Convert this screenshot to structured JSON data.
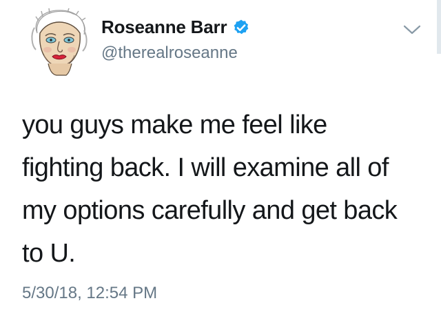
{
  "tweet": {
    "author": {
      "display_name": "Roseanne Barr",
      "handle": "@therealroseanne",
      "verified": true,
      "avatar": "sketched-portrait-avatar"
    },
    "text": "you guys make me feel like\nfighting back. I will examine all of\nmy options carefully and get back\nto U.",
    "timestamp": "5/30/18, 12:54 PM"
  },
  "icons": {
    "verified": "verified-badge-icon",
    "menu": "chevron-down-icon"
  },
  "colors": {
    "text": "#14171a",
    "secondary": "#657786",
    "verified_blue": "#1da1f2",
    "background": "#ffffff"
  }
}
